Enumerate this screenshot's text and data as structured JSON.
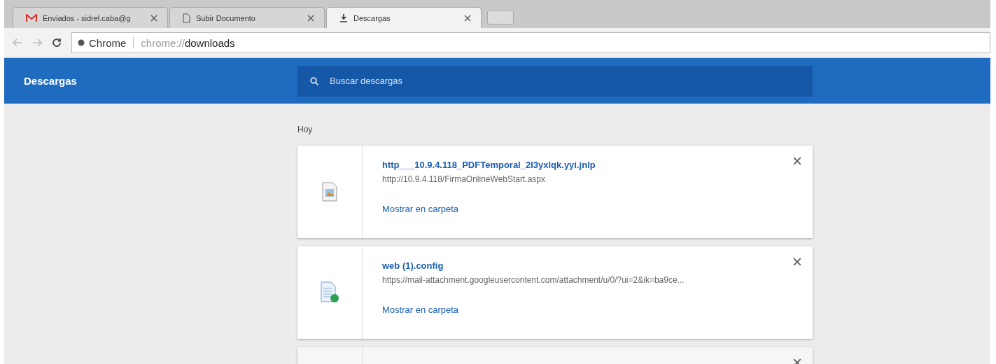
{
  "tabs": [
    {
      "kind": "mail",
      "label": "Enviados - sidrel.caba@g",
      "selected": false
    },
    {
      "kind": "page",
      "label": "Subir Documento",
      "selected": false
    },
    {
      "kind": "download",
      "label": "Descargas",
      "selected": true
    }
  ],
  "omnibox": {
    "site": "Chrome",
    "url_prefix": "chrome://",
    "url_host": "downloads"
  },
  "header": {
    "title": "Descargas",
    "search_placeholder": "Buscar descargas"
  },
  "section": "Hoy",
  "downloads": [
    {
      "kind": "image",
      "name": "http___10.9.4.118_PDFTemporal_2l3yxlqk.yyi.jnlp",
      "source": "http://10.9.4.118/FirmaOnlineWebStart.aspx",
      "action": "Mostrar en carpeta"
    },
    {
      "kind": "config",
      "name": "web (1).config",
      "source": "https://mail-attachment.googleusercontent.com/attachment/u/0/?ui=2&ik=ba9ce...",
      "action": "Mostrar en carpeta"
    },
    {
      "kind": "blank"
    }
  ]
}
